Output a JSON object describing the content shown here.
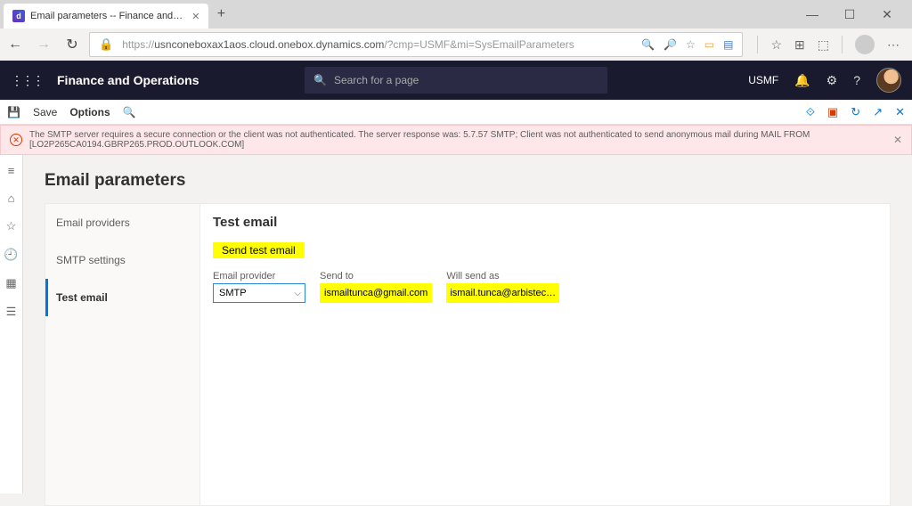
{
  "browser": {
    "tab_title": "Email parameters -- Finance and…",
    "url_prefix": "https://",
    "url_host": "usnconeboxax1aos.cloud.onebox.dynamics.com",
    "url_rest": "/?cmp=USMF&mi=SysEmailParameters"
  },
  "app": {
    "title": "Finance and Operations",
    "search_placeholder": "Search for a page",
    "company": "USMF"
  },
  "toolbar": {
    "save_label": "Save",
    "options_label": "Options"
  },
  "error": {
    "message": "The SMTP server requires a secure connection or the client was not authenticated. The server response was: 5.7.57 SMTP; Client was not authenticated to send anonymous mail during MAIL FROM [LO2P265CA0194.GBRP265.PROD.OUTLOOK.COM]"
  },
  "page": {
    "title": "Email parameters",
    "side_nav": [
      {
        "label": "Email providers"
      },
      {
        "label": "SMTP settings"
      },
      {
        "label": "Test email"
      }
    ],
    "panel_title": "Test email",
    "send_test_label": "Send test email",
    "fields": {
      "provider_label": "Email provider",
      "provider_value": "SMTP",
      "sendto_label": "Send to",
      "sendto_value": "ismailtunca@gmail.com",
      "sendas_label": "Will send as",
      "sendas_value": "ismail.tunca@arbistec…"
    }
  }
}
